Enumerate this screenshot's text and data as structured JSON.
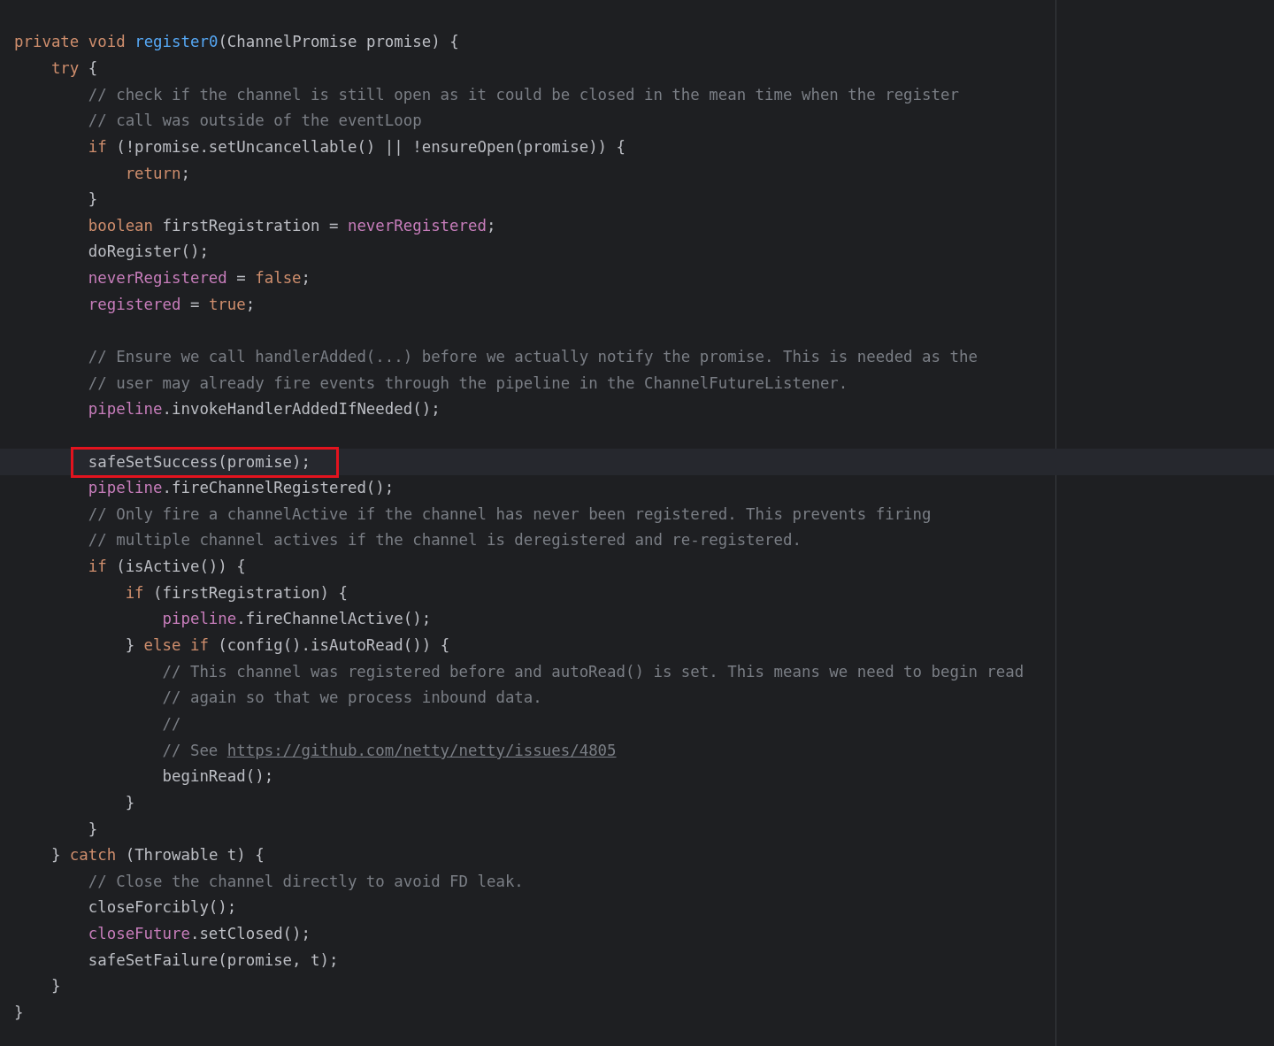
{
  "editor": {
    "lines": [
      {
        "kind": "code",
        "highlighted": false,
        "tokens": [
          {
            "kind": "keyword",
            "text": "private"
          },
          {
            "kind": "keyword",
            "text": "void"
          },
          {
            "kind": "method",
            "text": "register0"
          },
          {
            "kind": "plain",
            "text": "(ChannelPromise promise) {"
          }
        ],
        "children": [
          {
            "kind": "code",
            "highlighted": false,
            "tokens": [
              {
                "kind": "keyword",
                "text": "try"
              },
              {
                "kind": "plain",
                "text": " {"
              }
            ],
            "children": [
              {
                "kind": "code",
                "highlighted": false,
                "tokens": [
                  {
                    "kind": "comment",
                    "text": "// check if the channel is still open as it could be closed in the mean time when the register"
                  }
                ]
              },
              {
                "kind": "code",
                "highlighted": false,
                "tokens": [
                  {
                    "kind": "comment",
                    "text": "// call was outside of the eventLoop"
                  }
                ]
              },
              {
                "kind": "code",
                "highlighted": false,
                "tokens": [
                  {
                    "kind": "keyword",
                    "text": "if"
                  },
                  {
                    "kind": "plain",
                    "text": " (!promise.setUncancellable() || !ensureOpen(promise)) {"
                  }
                ],
                "children": [
                  {
                    "kind": "code",
                    "highlighted": false,
                    "tokens": [
                      {
                        "kind": "keyword",
                        "text": "return"
                      },
                      {
                        "kind": "plain",
                        "text": ";"
                      }
                    ]
                  }
                ]
              },
              {
                "kind": "code",
                "highlighted": false,
                "tokens": [
                  {
                    "kind": "plain",
                    "text": "}"
                  }
                ]
              },
              {
                "kind": "code",
                "highlighted": false,
                "tokens": [
                  {
                    "kind": "keyword",
                    "text": "boolean"
                  },
                  {
                    "kind": "plain",
                    "text": " firstRegistration = "
                  },
                  {
                    "kind": "field",
                    "text": "neverRegistered"
                  },
                  {
                    "kind": "plain",
                    "text": ";"
                  }
                ]
              },
              {
                "kind": "code",
                "highlighted": false,
                "tokens": [
                  {
                    "kind": "plain",
                    "text": "doRegister();"
                  }
                ]
              },
              {
                "kind": "code",
                "highlighted": false,
                "tokens": [
                  {
                    "kind": "field",
                    "text": "neverRegistered"
                  },
                  {
                    "kind": "plain",
                    "text": " = "
                  },
                  {
                    "kind": "keyword",
                    "text": "false"
                  },
                  {
                    "kind": "plain",
                    "text": ";"
                  }
                ]
              },
              {
                "kind": "code",
                "highlighted": false,
                "tokens": [
                  {
                    "kind": "field",
                    "text": "registered"
                  },
                  {
                    "kind": "plain",
                    "text": " = "
                  },
                  {
                    "kind": "keyword",
                    "text": "true"
                  },
                  {
                    "kind": "plain",
                    "text": ";"
                  }
                ]
              },
              {
                "kind": "blank",
                "highlighted": false
              },
              {
                "kind": "code",
                "highlighted": false,
                "tokens": [
                  {
                    "kind": "comment",
                    "text": "// Ensure we call handlerAdded(...) before we actually notify the promise. This is needed as the"
                  }
                ]
              },
              {
                "kind": "code",
                "highlighted": false,
                "tokens": [
                  {
                    "kind": "comment",
                    "text": "// user may already fire events through the pipeline in the ChannelFutureListener."
                  }
                ]
              },
              {
                "kind": "code",
                "highlighted": false,
                "tokens": [
                  {
                    "kind": "field",
                    "text": "pipeline"
                  },
                  {
                    "kind": "plain",
                    "text": ".invokeHandlerAddedIfNeeded();"
                  }
                ]
              },
              {
                "kind": "blank",
                "highlighted": false
              },
              {
                "kind": "code",
                "highlighted": true,
                "tokens": [
                  {
                    "kind": "plain",
                    "text": "safeSetSuccess(promise);"
                  }
                ]
              },
              {
                "kind": "code",
                "highlighted": false,
                "tokens": [
                  {
                    "kind": "field",
                    "text": "pipeline"
                  },
                  {
                    "kind": "plain",
                    "text": ".fireChannelRegistered();"
                  }
                ]
              },
              {
                "kind": "code",
                "highlighted": false,
                "tokens": [
                  {
                    "kind": "comment",
                    "text": "// Only fire a channelActive if the channel has never been registered. This prevents firing"
                  }
                ]
              },
              {
                "kind": "code",
                "highlighted": false,
                "tokens": [
                  {
                    "kind": "comment",
                    "text": "// multiple channel actives if the channel is deregistered and re-registered."
                  }
                ]
              },
              {
                "kind": "code",
                "highlighted": false,
                "tokens": [
                  {
                    "kind": "keyword",
                    "text": "if"
                  },
                  {
                    "kind": "plain",
                    "text": " (isActive()) {"
                  }
                ],
                "children": [
                  {
                    "kind": "code",
                    "highlighted": false,
                    "tokens": [
                      {
                        "kind": "keyword",
                        "text": "if"
                      },
                      {
                        "kind": "plain",
                        "text": " (firstRegistration) {"
                      }
                    ],
                    "children": [
                      {
                        "kind": "code",
                        "highlighted": false,
                        "tokens": [
                          {
                            "kind": "field",
                            "text": "pipeline"
                          },
                          {
                            "kind": "plain",
                            "text": ".fireChannelActive();"
                          }
                        ]
                      }
                    ]
                  },
                  {
                    "kind": "code",
                    "highlighted": false,
                    "tokens": [
                      {
                        "kind": "plain",
                        "text": "} "
                      },
                      {
                        "kind": "keyword",
                        "text": "else if"
                      },
                      {
                        "kind": "plain",
                        "text": " (config().isAutoRead()) {"
                      }
                    ],
                    "children": [
                      {
                        "kind": "code",
                        "highlighted": false,
                        "tokens": [
                          {
                            "kind": "comment",
                            "text": "// This channel was registered before and autoRead() is set. This means we need to begin read"
                          }
                        ]
                      },
                      {
                        "kind": "code",
                        "highlighted": false,
                        "tokens": [
                          {
                            "kind": "comment",
                            "text": "// again so that we process inbound data."
                          }
                        ]
                      },
                      {
                        "kind": "code",
                        "highlighted": false,
                        "tokens": [
                          {
                            "kind": "comment",
                            "text": "//"
                          }
                        ]
                      },
                      {
                        "kind": "code",
                        "highlighted": false,
                        "tokens": [
                          {
                            "kind": "comment",
                            "text": "// See "
                          },
                          {
                            "kind": "link",
                            "text": "https://github.com/netty/netty/issues/4805"
                          }
                        ]
                      },
                      {
                        "kind": "code",
                        "highlighted": false,
                        "tokens": [
                          {
                            "kind": "plain",
                            "text": "beginRead();"
                          }
                        ]
                      }
                    ]
                  },
                  {
                    "kind": "code",
                    "highlighted": false,
                    "tokens": [
                      {
                        "kind": "plain",
                        "text": "}"
                      }
                    ]
                  }
                ]
              },
              {
                "kind": "code",
                "highlighted": false,
                "tokens": [
                  {
                    "kind": "plain",
                    "text": "}"
                  }
                ]
              }
            ]
          },
          {
            "kind": "code",
            "highlighted": false,
            "tokens": [
              {
                "kind": "plain",
                "text": "} "
              },
              {
                "kind": "keyword",
                "text": "catch"
              },
              {
                "kind": "plain",
                "text": " (Throwable t) {"
              }
            ],
            "children": [
              {
                "kind": "code",
                "highlighted": false,
                "tokens": [
                  {
                    "kind": "comment",
                    "text": "// Close the channel directly to avoid FD leak."
                  }
                ]
              },
              {
                "kind": "code",
                "highlighted": false,
                "tokens": [
                  {
                    "kind": "plain",
                    "text": "closeForcibly();"
                  }
                ]
              },
              {
                "kind": "code",
                "highlighted": false,
                "tokens": [
                  {
                    "kind": "field",
                    "text": "closeFuture"
                  },
                  {
                    "kind": "plain",
                    "text": ".setClosed();"
                  }
                ]
              },
              {
                "kind": "code",
                "highlighted": false,
                "tokens": [
                  {
                    "kind": "plain",
                    "text": "safeSetFailure(promise, t);"
                  }
                ]
              }
            ]
          },
          {
            "kind": "code",
            "highlighted": false,
            "tokens": [
              {
                "kind": "plain",
                "text": "}"
              }
            ]
          }
        ]
      },
      {
        "kind": "code",
        "highlighted": false,
        "tokens": [
          {
            "kind": "plain",
            "text": "}"
          }
        ]
      }
    ]
  }
}
